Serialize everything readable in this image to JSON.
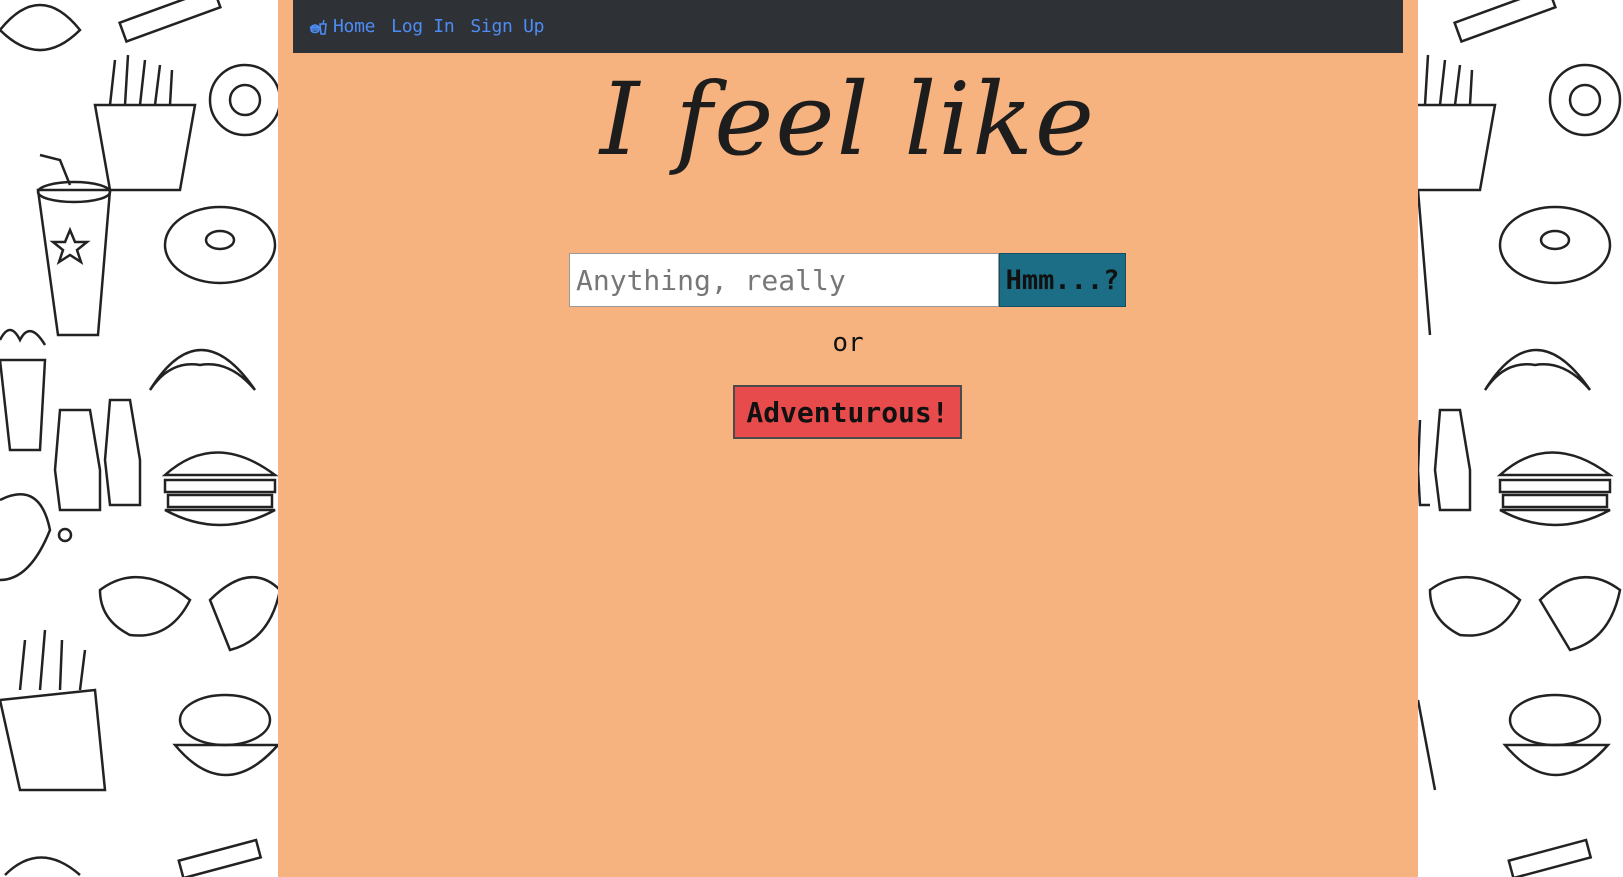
{
  "navbar": {
    "icon": "burger-drink-icon",
    "items": [
      {
        "label": "Home"
      },
      {
        "label": "Log In"
      },
      {
        "label": "Sign Up"
      }
    ]
  },
  "hero": {
    "title": "I feel like"
  },
  "search": {
    "placeholder": "Anything, really",
    "value": "",
    "button_label": "Hmm...?"
  },
  "separator": {
    "text": "or"
  },
  "adventure": {
    "button_label": "Adventurous!"
  },
  "colors": {
    "panel_bg": "#f6b27f",
    "navbar_bg": "#2e3136",
    "nav_link": "#4d8cf5",
    "search_button": "#1c6e87",
    "adventure_button": "#e84b4b"
  }
}
